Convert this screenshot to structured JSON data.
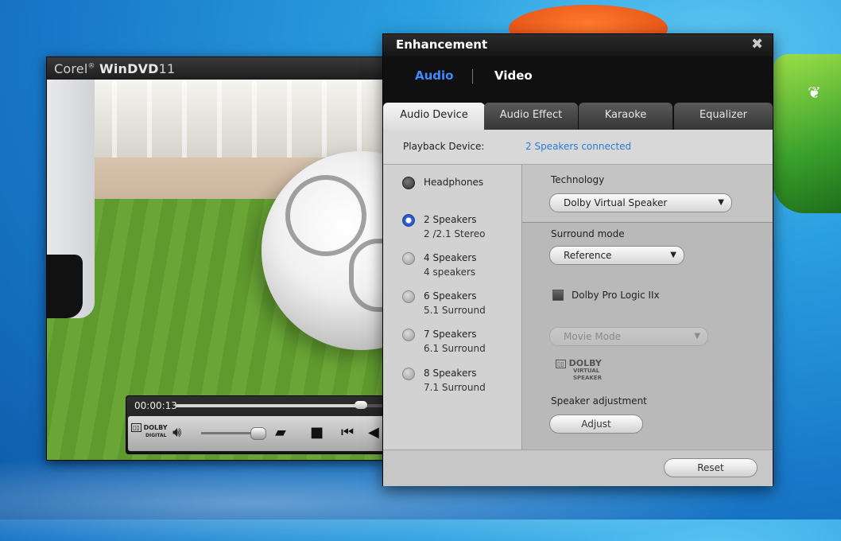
{
  "player": {
    "title_brand": "Corel",
    "title_reg": "®",
    "title_product": "WinDVD",
    "title_version": "11",
    "time": "00:00:13",
    "seek_progress": 0.87,
    "volume_level": 0.9,
    "dolby_top": "DOLBY",
    "dolby_bottom": "DIGITAL"
  },
  "dialog": {
    "title": "Enhancement",
    "close": "✖",
    "modes": [
      "Audio",
      "Video"
    ],
    "active_mode": "Audio",
    "tabs": [
      "Audio Device",
      "Audio Effect",
      "Karaoke",
      "Equalizer"
    ],
    "active_tab": "Audio Device",
    "playback_device_label": "Playback Device:",
    "playback_device_value": "2 Speakers connected",
    "options": [
      {
        "label": "Headphones",
        "sub": ""
      },
      {
        "label": "2 Speakers",
        "sub": "2 /2.1 Stereo"
      },
      {
        "label": "4 Speakers",
        "sub": "4 speakers"
      },
      {
        "label": "6 Speakers",
        "sub": "5.1 Surround"
      },
      {
        "label": "7 Speakers",
        "sub": "6.1 Surround"
      },
      {
        "label": "8 Speakers",
        "sub": "7.1 Surround"
      }
    ],
    "selected_option": "2 Speakers",
    "technology_label": "Technology",
    "technology_value": "Dolby Virtual Speaker",
    "surround_label": "Surround mode",
    "surround_value": "Reference",
    "pro_logic_label": "Dolby Pro Logic IIx",
    "pro_logic_checked": false,
    "movie_mode_value": "Movie Mode",
    "dolby_vs_top": "DOLBY",
    "dolby_vs_bottom": "VIRTUAL SPEAKER",
    "speaker_adjust_label": "Speaker adjustment",
    "adjust_button": "Adjust",
    "reset_button": "Reset"
  },
  "colors": {
    "accent_blue": "#3d8bff",
    "link_blue": "#2a7bd4"
  }
}
